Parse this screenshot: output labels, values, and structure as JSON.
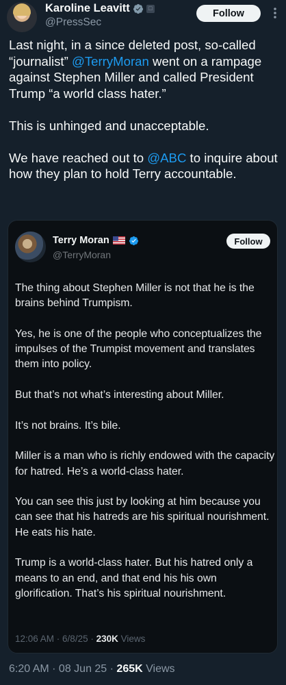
{
  "post": {
    "author": {
      "display_name": "Karoline Leavitt",
      "handle": "@PressSec",
      "verified": true,
      "badge_icon": "government-badge-icon"
    },
    "follow_label": "Follow",
    "body": {
      "p1_a": "Last night, in a since deleted post, so-called “journalist” ",
      "p1_mention": "@TerryMoran",
      "p1_b": " went on a rampage against Stephen Miller and called President Trump “a world class hater.”",
      "p2": "This is unhinged and unacceptable.",
      "p3_a": "We have reached out to ",
      "p3_mention": "@ABC",
      "p3_b": " to inquire about how they plan to hold Terry accountable."
    },
    "timestamp": "6:20 AM",
    "date": "08 Jun 25",
    "views_count": "265K",
    "views_label": "Views"
  },
  "quote": {
    "author": {
      "display_name": "Terry Moran",
      "handle": "@TerryMoran",
      "flag_icon": "us-flag-icon",
      "verified": true
    },
    "follow_label": "Follow",
    "paragraphs": [
      "The thing about Stephen Miller is not that he is the brains behind Trumpism.",
      "Yes, he is one of the people who conceptualizes the impulses of the Trumpist movement and translates them into policy.",
      "But that’s not what’s interesting about Miller.",
      "It’s not brains. It’s bile.",
      "Miller is a man who is richly endowed with the capacity for hatred. He’s a world-class hater.",
      "You can see this just by looking at him because you can see that his hatreds are his spiritual nourishment. He eats his hate.",
      "Trump is a world-class hater. But his hatred only a means to an end, and that end his his own glorification. That’s his spiritual nourishment."
    ],
    "timestamp": "12:06 AM",
    "date": "6/8/25",
    "views_count": "230K",
    "views_label": "Views"
  },
  "colors": {
    "background": "#15202b",
    "accent": "#1d9bf0",
    "secondary_text": "#8b98a5"
  }
}
